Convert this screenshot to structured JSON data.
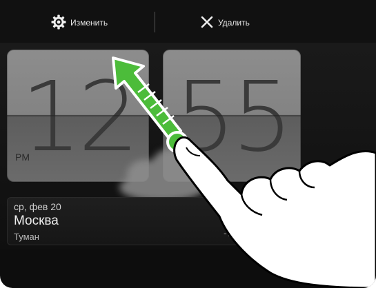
{
  "action_bar": {
    "edit_label": "Изменить",
    "delete_label": "Удалить"
  },
  "clock": {
    "hours": "12",
    "minutes": "55",
    "ampm": "PM"
  },
  "weather": {
    "date": "ср, фев 20",
    "city": "Москва",
    "condition": "Туман",
    "temperature": "-7°c /"
  },
  "colors": {
    "screen_background": "#0d0d0d",
    "flip_panel": "#838383",
    "gesture_arrow": "#4cbc3a"
  },
  "icons": {
    "edit": "gear-icon",
    "delete": "close-icon",
    "weather": "cloud-icon",
    "gesture": "swipe-up-arrow-icon",
    "hand": "pointing-hand-icon"
  }
}
